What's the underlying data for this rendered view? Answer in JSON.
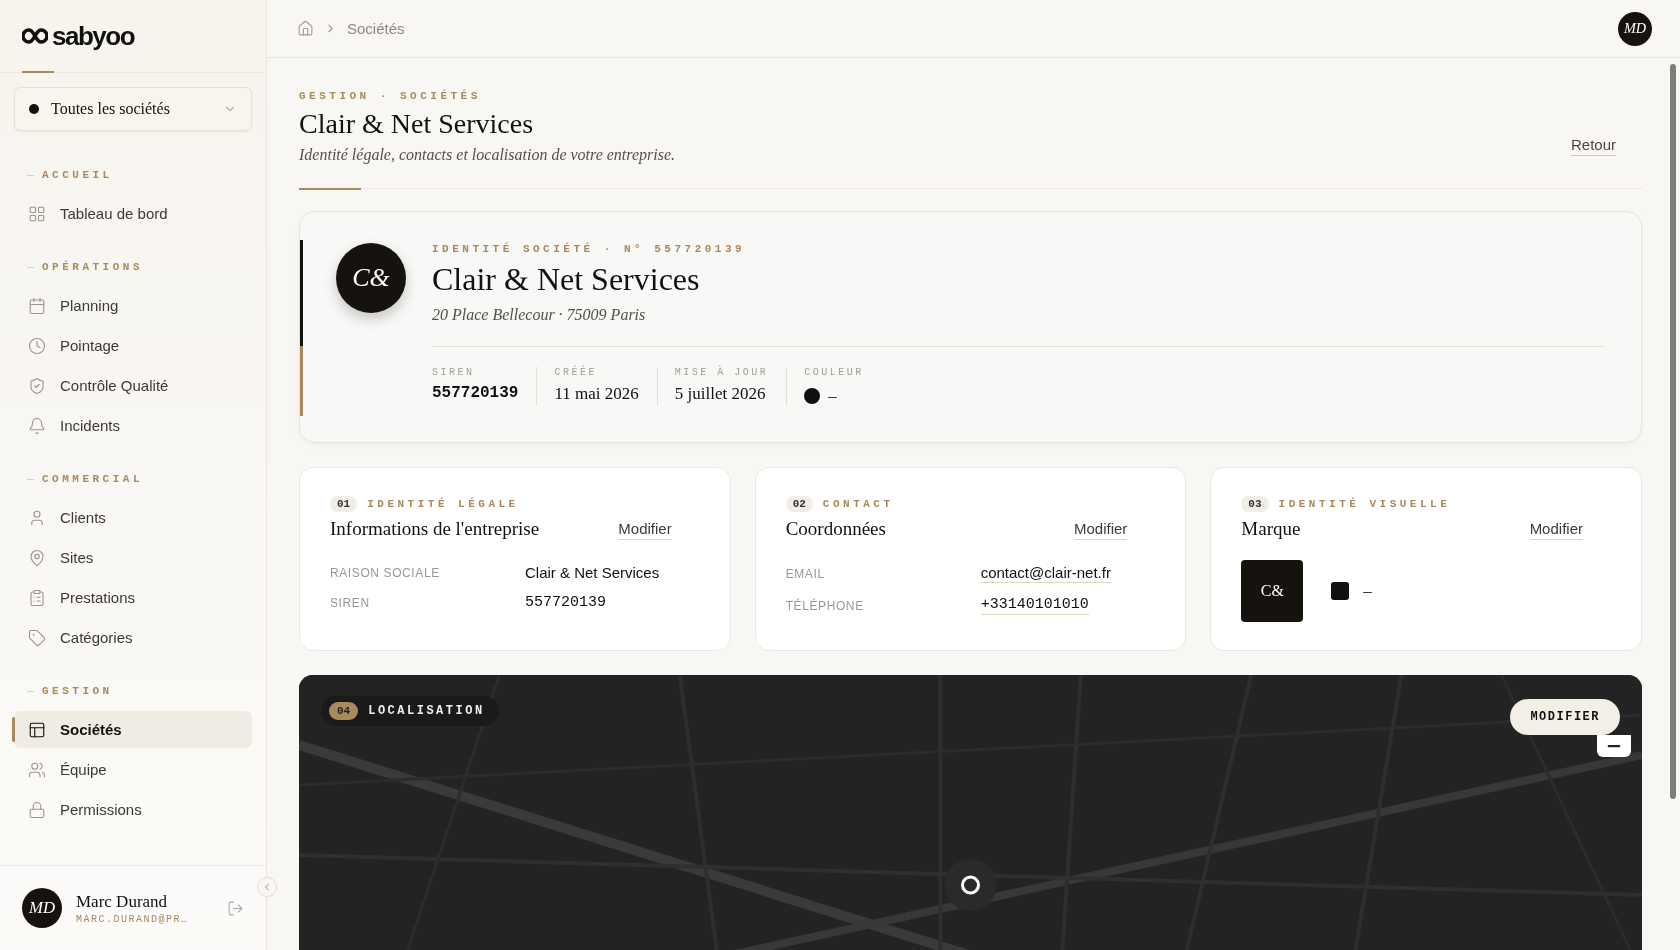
{
  "sidebar": {
    "logo": "sabyoo",
    "company_selector": {
      "label": "Toutes les sociétés"
    },
    "sections": [
      {
        "title": "ACCUEIL",
        "items": [
          {
            "label": "Tableau de bord",
            "selected": false
          }
        ]
      },
      {
        "title": "OPÉRATIONS",
        "items": [
          {
            "label": "Planning",
            "selected": false
          },
          {
            "label": "Pointage",
            "selected": false
          },
          {
            "label": "Contrôle Qualité",
            "selected": false
          },
          {
            "label": "Incidents",
            "selected": false
          }
        ]
      },
      {
        "title": "COMMERCIAL",
        "items": [
          {
            "label": "Clients",
            "selected": false
          },
          {
            "label": "Sites",
            "selected": false
          },
          {
            "label": "Prestations",
            "selected": false
          },
          {
            "label": "Catégories",
            "selected": false
          }
        ]
      },
      {
        "title": "GESTION",
        "items": [
          {
            "label": "Sociétés",
            "selected": true
          },
          {
            "label": "Équipe",
            "selected": false
          },
          {
            "label": "Permissions",
            "selected": false
          }
        ]
      }
    ],
    "user": {
      "initials": "MD",
      "name": "Marc Durand",
      "email": "MARC.DURAND@PR…"
    }
  },
  "header": {
    "breadcrumb": "Sociétés",
    "avatar": "MD"
  },
  "page": {
    "eyebrow": "GESTION · SOCIÉTÉS",
    "title": "Clair & Net Services",
    "subtitle": "Identité légale, contacts et localisation de votre entreprise.",
    "back_link": "Retour"
  },
  "identity": {
    "eyebrow": "IDENTITÉ SOCIÉTÉ · N° 557720139",
    "monogram": "C&",
    "name": "Clair & Net Services",
    "address": "20 Place Bellecour · 75009 Paris",
    "facts": [
      {
        "label": "SIREN",
        "value": "557720139",
        "kind": "mono"
      },
      {
        "label": "CRÉÉE",
        "value": "11 mai 2026",
        "kind": "serif"
      },
      {
        "label": "MISE À JOUR",
        "value": "5 juillet 2026",
        "kind": "serif"
      },
      {
        "label": "COULEUR",
        "value": "–",
        "kind": "color",
        "color": "#111111"
      }
    ]
  },
  "cards": [
    {
      "number": "01",
      "eyebrow": "IDENTITÉ LÉGALE",
      "title": "Informations de l'entreprise",
      "action": "Modifier",
      "kind": "fields",
      "fields": [
        {
          "label": "RAISON SOCIALE",
          "value": "Clair & Net Services",
          "kind": "text"
        },
        {
          "label": "SIREN",
          "value": "557720139",
          "kind": "mono"
        }
      ]
    },
    {
      "number": "02",
      "eyebrow": "CONTACT",
      "title": "Coordonnées",
      "action": "Modifier",
      "kind": "fields",
      "fields": [
        {
          "label": "EMAIL",
          "value": "contact@clair-net.fr",
          "kind": "link"
        },
        {
          "label": "TÉLÉPHONE",
          "value": "+33140101010",
          "kind": "monolink"
        }
      ]
    },
    {
      "number": "03",
      "eyebrow": "IDENTITÉ VISUELLE",
      "title": "Marque",
      "action": "Modifier",
      "kind": "brand",
      "monogram": "C&",
      "color": "#111111",
      "color_label": "–"
    }
  ],
  "map": {
    "number": "04",
    "label": "LOCALISATION",
    "action": "MODIFIER",
    "kind": "picture"
  }
}
